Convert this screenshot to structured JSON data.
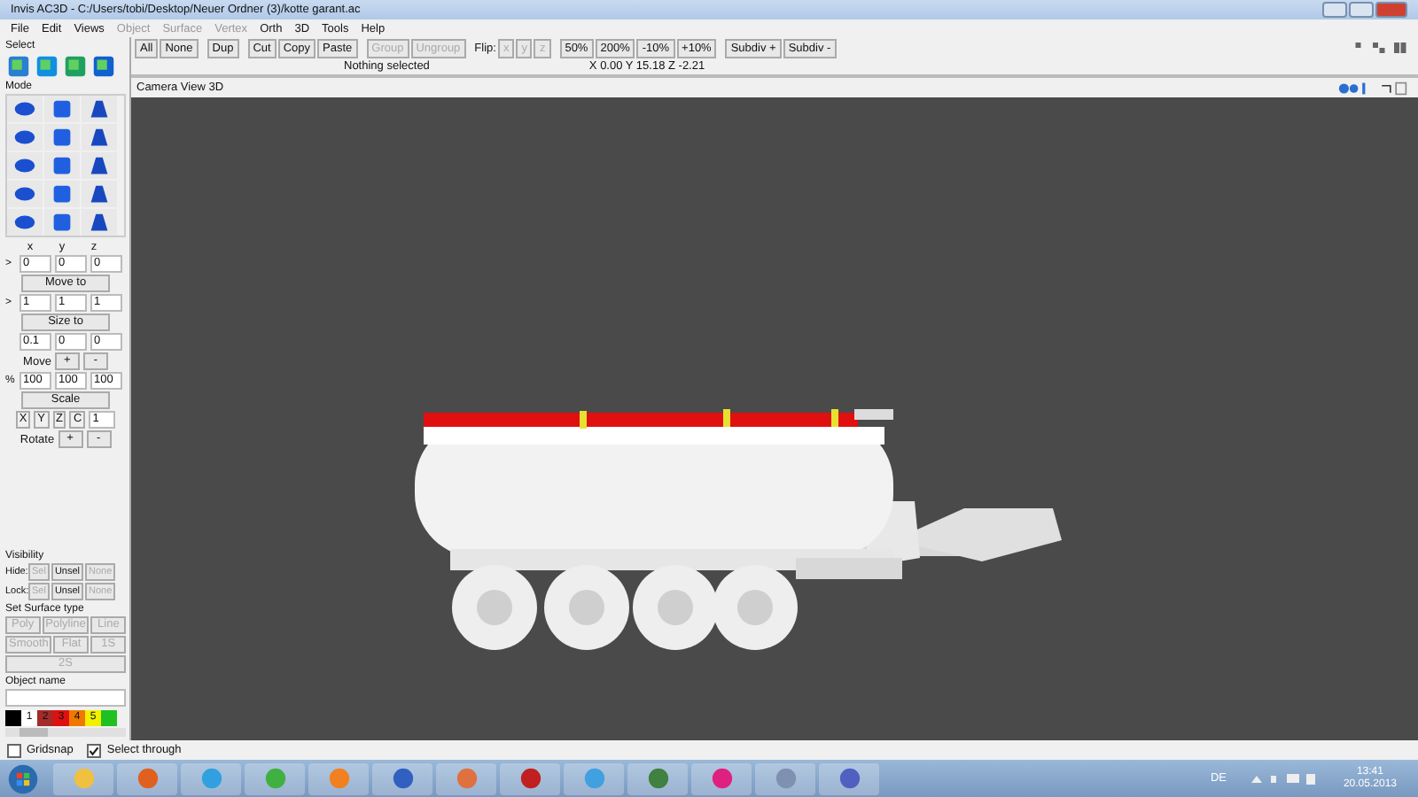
{
  "window": {
    "title": "Invis AC3D - C:/Users/tobi/Desktop/Neuer Ordner (3)/kotte garant.ac"
  },
  "menu": [
    {
      "label": "File",
      "disabled": false
    },
    {
      "label": "Edit",
      "disabled": false
    },
    {
      "label": "Views",
      "disabled": false
    },
    {
      "label": "Object",
      "disabled": true
    },
    {
      "label": "Surface",
      "disabled": true
    },
    {
      "label": "Vertex",
      "disabled": true
    },
    {
      "label": "Orth",
      "disabled": false
    },
    {
      "label": "3D",
      "disabled": false
    },
    {
      "label": "Tools",
      "disabled": false
    },
    {
      "label": "Help",
      "disabled": false
    }
  ],
  "panel": {
    "select_label": "Select",
    "mode_label": "Mode",
    "axes": [
      "x",
      "y",
      "z"
    ],
    "rows": [
      {
        "kind": "fields",
        "marker": ">",
        "values": [
          "0",
          "0",
          "0"
        ]
      },
      {
        "kind": "button",
        "label": "Move to"
      },
      {
        "kind": "fields",
        "marker": ">",
        "values": [
          "1",
          "1",
          "1"
        ]
      },
      {
        "kind": "button",
        "label": "Size to"
      },
      {
        "kind": "fields",
        "values": [
          "0.1",
          "0",
          "0"
        ]
      },
      {
        "kind": "pm",
        "label": "Move",
        "plus": "+",
        "minus": "-"
      },
      {
        "kind": "fields",
        "marker": "%",
        "values": [
          "100",
          "100",
          "100"
        ]
      },
      {
        "kind": "button",
        "label": "Scale"
      },
      {
        "kind": "axis",
        "toggles": [
          "X",
          "Y",
          "Z",
          "C"
        ],
        "value": "1"
      },
      {
        "kind": "pm",
        "label": "Rotate",
        "plus": "+",
        "minus": "-"
      }
    ],
    "visibility": {
      "title": "Visibility",
      "rows": [
        {
          "label": "Hide:",
          "buttons": [
            {
              "text": "Sel",
              "disabled": true
            },
            {
              "text": "Unsel",
              "disabled": false
            },
            {
              "text": "None",
              "disabled": true
            }
          ]
        },
        {
          "label": "Lock:",
          "buttons": [
            {
              "text": "Sel",
              "disabled": true
            },
            {
              "text": "Unsel",
              "disabled": false
            },
            {
              "text": "None",
              "disabled": true
            }
          ]
        }
      ]
    },
    "surface": {
      "title": "Set Surface type",
      "buttons": [
        "Poly",
        "Polyline",
        "Line",
        "Smooth",
        "Flat",
        "1S",
        "2S"
      ]
    },
    "object_name": {
      "title": "Object name"
    },
    "palette": [
      {
        "color": "#000000"
      },
      {
        "label": "1",
        "color": "#ffffff"
      },
      {
        "label": "2",
        "color": "#a52a2a"
      },
      {
        "label": "3",
        "color": "#e01010"
      },
      {
        "label": "4",
        "color": "#f07800"
      },
      {
        "label": "5",
        "color": "#f0f000"
      },
      {
        "color": "#20c020"
      }
    ]
  },
  "toolbar": [
    {
      "buttons": [
        {
          "text": "All",
          "disabled": false
        },
        {
          "text": "None",
          "disabled": false
        }
      ]
    },
    {
      "buttons": [
        {
          "text": "Dup",
          "disabled": false
        }
      ]
    },
    {
      "buttons": [
        {
          "text": "Cut",
          "disabled": false
        },
        {
          "text": "Copy",
          "disabled": false
        },
        {
          "text": "Paste",
          "disabled": false
        }
      ]
    },
    {
      "buttons": [
        {
          "text": "Group",
          "disabled": true
        },
        {
          "text": "Ungroup",
          "disabled": true
        }
      ]
    },
    {
      "label": "Flip:",
      "buttons": [
        {
          "text": "x",
          "disabled": true
        },
        {
          "text": "y",
          "disabled": true
        },
        {
          "text": "z",
          "disabled": true
        }
      ]
    },
    {
      "buttons": [
        {
          "text": "50%",
          "disabled": false
        },
        {
          "text": "200%",
          "disabled": false
        },
        {
          "text": "-10%",
          "disabled": false
        },
        {
          "text": "+10%",
          "disabled": false
        }
      ]
    },
    {
      "buttons": [
        {
          "text": "Subdiv +",
          "disabled": false
        },
        {
          "text": "Subdiv -",
          "disabled": false
        }
      ]
    }
  ],
  "status": "Nothing selected",
  "coords": "X 0.00 Y 15.18 Z -2.21",
  "viewport": {
    "title": "Camera View 3D"
  },
  "options": [
    {
      "label": "Gridsnap",
      "checked": false
    },
    {
      "label": "Select through",
      "checked": true
    }
  ],
  "taskbar": {
    "language": "DE",
    "time": "13:41",
    "date": "20.05.2013"
  }
}
